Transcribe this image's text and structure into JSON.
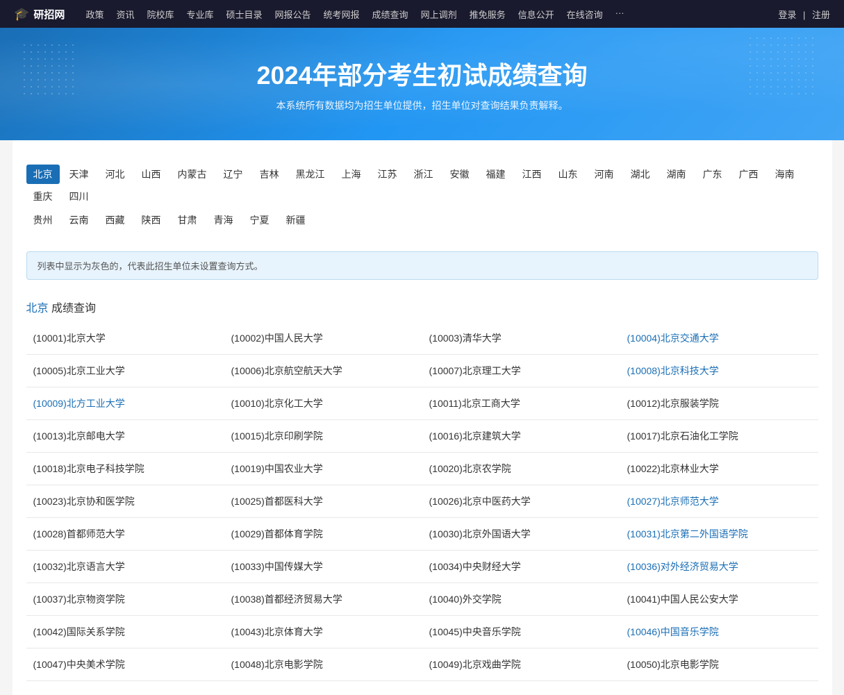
{
  "navbar": {
    "logo": "研招网",
    "cap_icon": "🎓",
    "links": [
      "政策",
      "资讯",
      "院校库",
      "专业库",
      "硕士目录",
      "网报公告",
      "统考网报",
      "成绩查询",
      "网上调剂",
      "推免服务",
      "信息公开",
      "在线咨询",
      "···"
    ],
    "login": "登录",
    "register": "注册"
  },
  "hero": {
    "title": "2024年部分考生初试成绩查询",
    "subtitle": "本系统所有数据均为招生单位提供，招生单位对查询结果负责解释。"
  },
  "provinces_row1": [
    "北京",
    "天津",
    "河北",
    "山西",
    "内蒙古",
    "辽宁",
    "吉林",
    "黑龙江",
    "上海",
    "江苏",
    "浙江",
    "安徽",
    "福建",
    "江西",
    "山东",
    "河南",
    "湖北",
    "湖南",
    "广东",
    "广西",
    "海南",
    "重庆",
    "四川"
  ],
  "provinces_row2": [
    "贵州",
    "云南",
    "西藏",
    "陕西",
    "甘肃",
    "青海",
    "宁夏",
    "新疆"
  ],
  "active_province": "北京",
  "info_text": "列表中显示为灰色的，代表此招生单位未设置查询方式。",
  "section_title": "北京 成绩查询",
  "universities": [
    [
      "(10001)北京大学",
      "(10002)中国人民大学",
      "(10003)清华大学",
      "(10004)北京交通大学"
    ],
    [
      "(10005)北京工业大学",
      "(10006)北京航空航天大学",
      "(10007)北京理工大学",
      "(10008)北京科技大学"
    ],
    [
      "(10009)北方工业大学",
      "(10010)北京化工大学",
      "(10011)北京工商大学",
      "(10012)北京服装学院"
    ],
    [
      "(10013)北京邮电大学",
      "(10015)北京印刷学院",
      "(10016)北京建筑大学",
      "(10017)北京石油化工学院"
    ],
    [
      "(10018)北京电子科技学院",
      "(10019)中国农业大学",
      "(10020)北京农学院",
      "(10022)北京林业大学"
    ],
    [
      "(10023)北京协和医学院",
      "(10025)首都医科大学",
      "(10026)北京中医药大学",
      "(10027)北京师范大学"
    ],
    [
      "(10028)首都师范大学",
      "(10029)首都体育学院",
      "(10030)北京外国语大学",
      "(10031)北京第二外国语学院"
    ],
    [
      "(10032)北京语言大学",
      "(10033)中国传媒大学",
      "(10034)中央财经大学",
      "(10036)对外经济贸易大学"
    ],
    [
      "(10037)北京物资学院",
      "(10038)首都经济贸易大学",
      "(10040)外交学院",
      "(10041)中国人民公安大学"
    ],
    [
      "(10042)国际关系学院",
      "(10043)北京体育大学",
      "(10045)中央音乐学院",
      "(10046)中国音乐学院"
    ],
    [
      "(10047)中央美术学院",
      "(10048)北京电影学院",
      "(10049)北京戏曲学院",
      "(10050)北京电影学院"
    ]
  ],
  "clickable_indices": {
    "0": [
      3
    ],
    "1": [
      3
    ],
    "2": [
      0
    ],
    "3": [],
    "4": [],
    "5": [
      3
    ],
    "6": [
      3
    ],
    "7": [
      3
    ],
    "8": [],
    "9": [
      3
    ],
    "10": []
  }
}
